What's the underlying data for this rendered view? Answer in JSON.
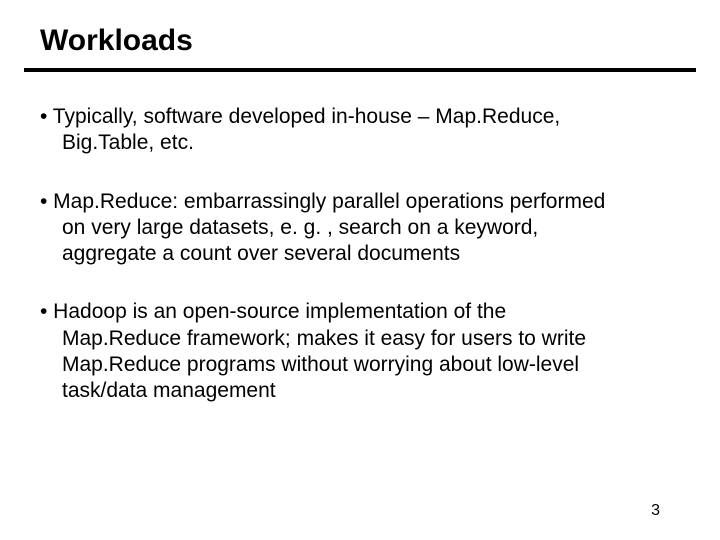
{
  "title": "Workloads",
  "bullets": [
    {
      "line1": "• Typically, software developed in-house – Map.Reduce,",
      "line2": "Big.Table, etc."
    },
    {
      "line1": "• Map.Reduce: embarrassingly parallel operations performed",
      "line2": "on very large datasets, e. g. , search on a keyword,",
      "line3": "aggregate a count over several documents"
    },
    {
      "line1": "• Hadoop is an open-source implementation of the",
      "line2": "Map.Reduce framework; makes it easy for users to write",
      "line3": "Map.Reduce programs without worrying about low-level",
      "line4": "task/data management"
    }
  ],
  "page_number": "3"
}
